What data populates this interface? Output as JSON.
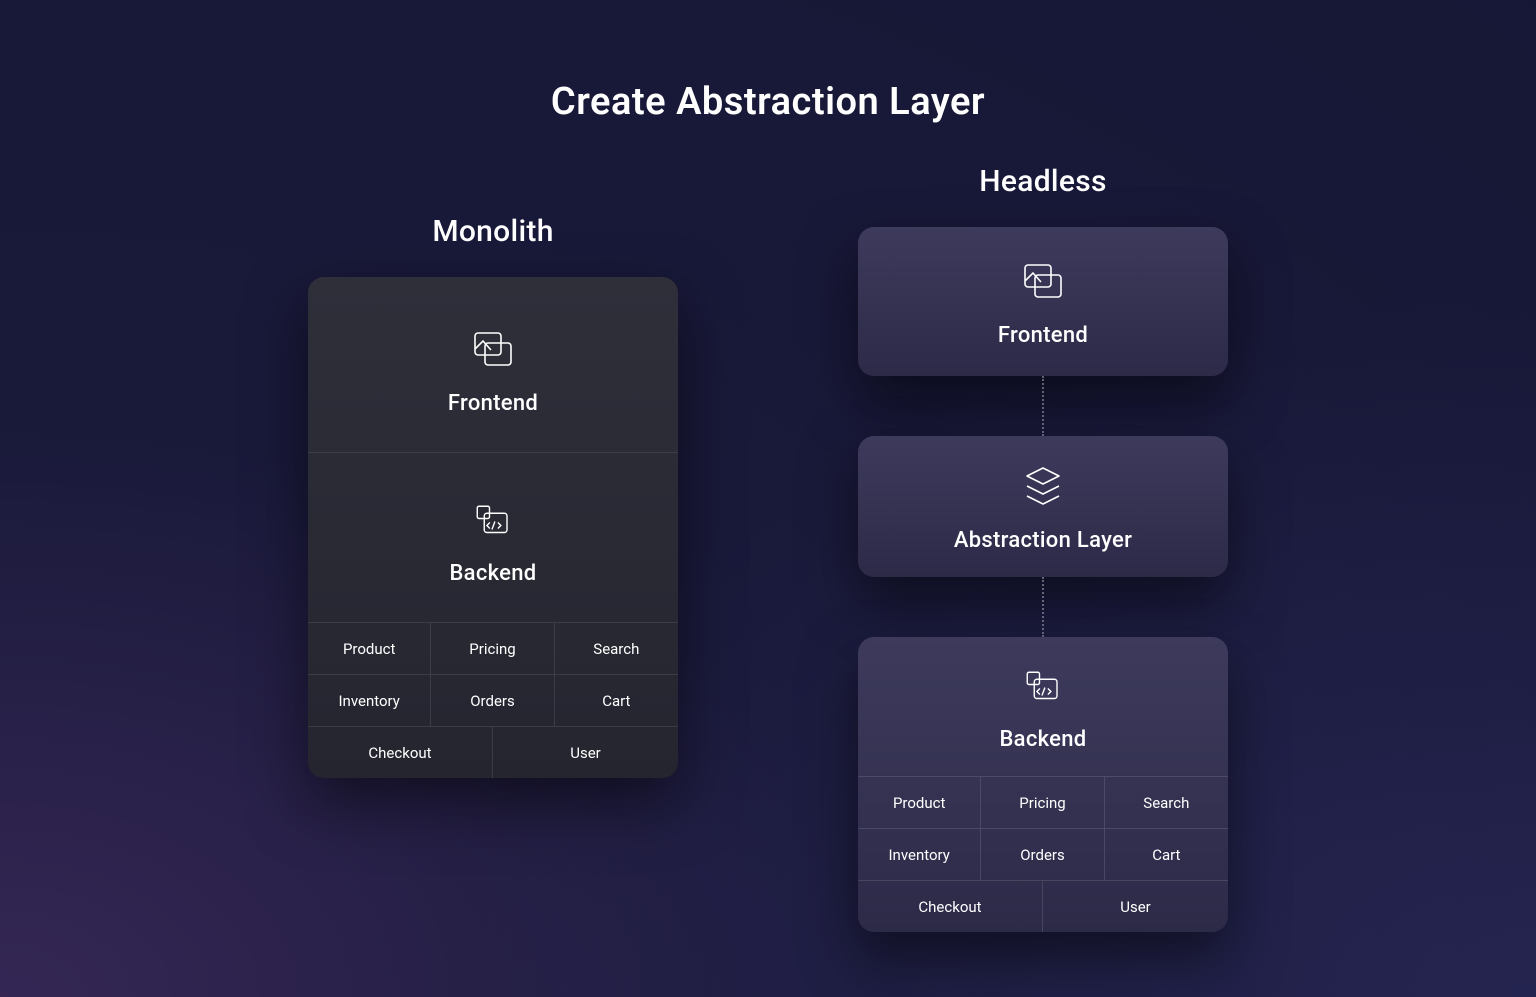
{
  "title": "Create Abstraction Layer",
  "monolith": {
    "heading": "Monolith",
    "frontend_label": "Frontend",
    "backend_label": "Backend",
    "services": [
      "Product",
      "Pricing",
      "Search",
      "Inventory",
      "Orders",
      "Cart",
      "Checkout",
      "User"
    ]
  },
  "headless": {
    "heading": "Headless",
    "frontend_label": "Frontend",
    "abstraction_label": "Abstraction Layer",
    "backend_label": "Backend",
    "services": [
      "Product",
      "Pricing",
      "Search",
      "Inventory",
      "Orders",
      "Cart",
      "Checkout",
      "User"
    ]
  }
}
